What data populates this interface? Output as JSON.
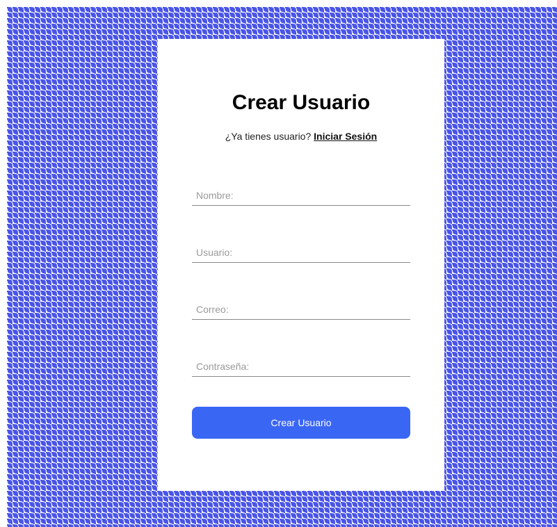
{
  "form": {
    "title": "Crear Usuario",
    "subtitle_text": "¿Ya tienes usuario?",
    "login_link": "Iniciar Sesión",
    "fields": {
      "name_placeholder": "Nombre:",
      "username_placeholder": "Usuario:",
      "email_placeholder": "Correo:",
      "password_placeholder": "Contraseña:"
    },
    "submit_label": "Crear Usuario"
  },
  "colors": {
    "pattern": "#4a55e6",
    "button": "#3a66f4",
    "card": "#ffffff"
  }
}
